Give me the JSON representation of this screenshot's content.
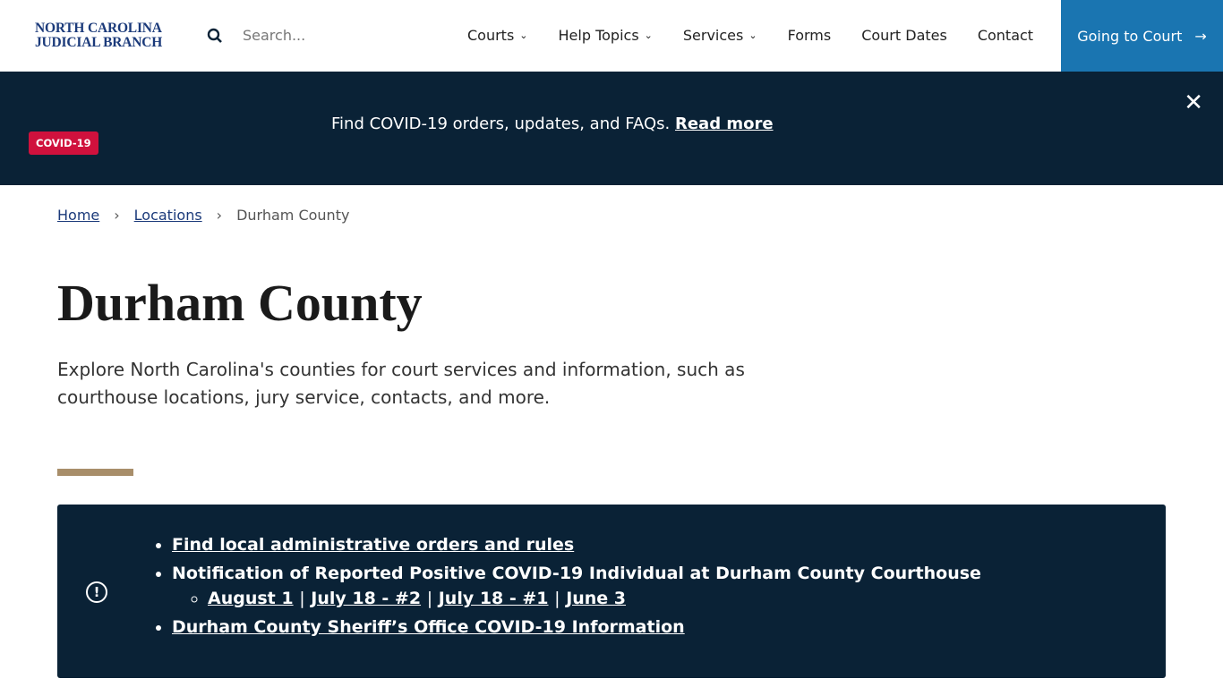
{
  "header": {
    "logo_line1": "NORTH CAROLINA",
    "logo_line2": "JUDICIAL BRANCH",
    "search_placeholder": "Search...",
    "nav": [
      "Courts",
      "Help Topics",
      "Services",
      "Forms",
      "Court Dates",
      "Contact"
    ],
    "cta": "Going to Court"
  },
  "banner": {
    "badge": "COVID-19",
    "text": "Find COVID-19 orders, updates, and FAQs.",
    "link": "Read more"
  },
  "breadcrumb": [
    "Home",
    "Locations",
    "Durham County"
  ],
  "page": {
    "title": "Durham County",
    "lead": "Explore North Carolina's counties for court services and information, such as courthouse locations, jury service, contacts, and more."
  },
  "alert": {
    "item1": "Find local administrative orders and rules",
    "item2": "Notification of Reported Positive COVID-19 Individual at Durham County Courthouse",
    "sublinks": [
      "August 1",
      "July 18 - #2",
      "July 18 - #1",
      "June 3"
    ],
    "separator": "|",
    "item3": "Durham County Sheriff’s Office COVID-19 Information"
  }
}
